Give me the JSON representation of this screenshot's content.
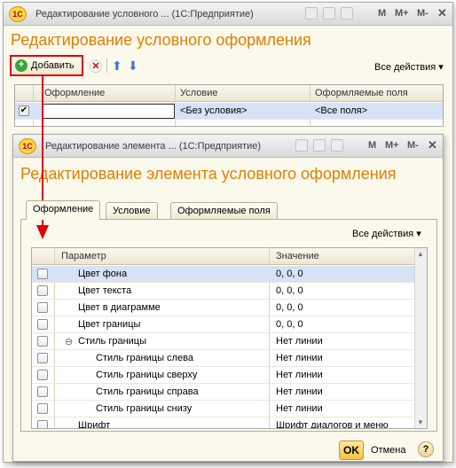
{
  "back_window": {
    "title": "Редактирование условного ... (1С:Предприятие)",
    "mbuttons": [
      "M",
      "M+",
      "M-"
    ],
    "logo": "1С",
    "heading": "Редактирование условного оформления",
    "toolbar": {
      "add_label": "Добавить",
      "all_actions": "Все действия ▾"
    },
    "columns": [
      "Оформление",
      "Условие",
      "Оформляемые поля"
    ],
    "rows": [
      {
        "checked": "✔",
        "formatting": "",
        "condition": "<Без условия>",
        "fields": "<Все поля>"
      }
    ]
  },
  "front_window": {
    "title": "Редактирование элемента ... (1С:Предприятие)",
    "mbuttons": [
      "M",
      "M+",
      "M-"
    ],
    "logo": "1С",
    "heading": "Редактирование элемента условного оформления",
    "tabs": [
      "Оформление",
      "Условие",
      "Оформляемые поля"
    ],
    "all_actions": "Все действия ▾",
    "columns": [
      "Параметр",
      "Значение"
    ],
    "rows": [
      {
        "name": "Цвет фона",
        "value": "0, 0, 0",
        "indent": 1
      },
      {
        "name": "Цвет текста",
        "value": "0, 0, 0",
        "indent": 1
      },
      {
        "name": "Цвет в диаграмме",
        "value": "0, 0, 0",
        "indent": 1
      },
      {
        "name": "Цвет границы",
        "value": "0, 0, 0",
        "indent": 1
      },
      {
        "name": "Стиль границы",
        "value": "Нет линии",
        "indent": 0,
        "expander": "⊖"
      },
      {
        "name": "Стиль границы слева",
        "value": "Нет линии",
        "indent": 2
      },
      {
        "name": "Стиль границы сверху",
        "value": "Нет линии",
        "indent": 2
      },
      {
        "name": "Стиль границы справа",
        "value": "Нет линии",
        "indent": 2
      },
      {
        "name": "Стиль границы снизу",
        "value": "Нет линии",
        "indent": 2
      },
      {
        "name": "Шрифт",
        "value": "Шрифт диалогов и меню",
        "indent": 1
      }
    ],
    "ok_label": "OK",
    "cancel_label": "Отмена",
    "help_label": "?"
  },
  "colors": {
    "accent_red": "#e00000",
    "heading_orange": "#e08000",
    "selection": "#d7e2f6"
  }
}
